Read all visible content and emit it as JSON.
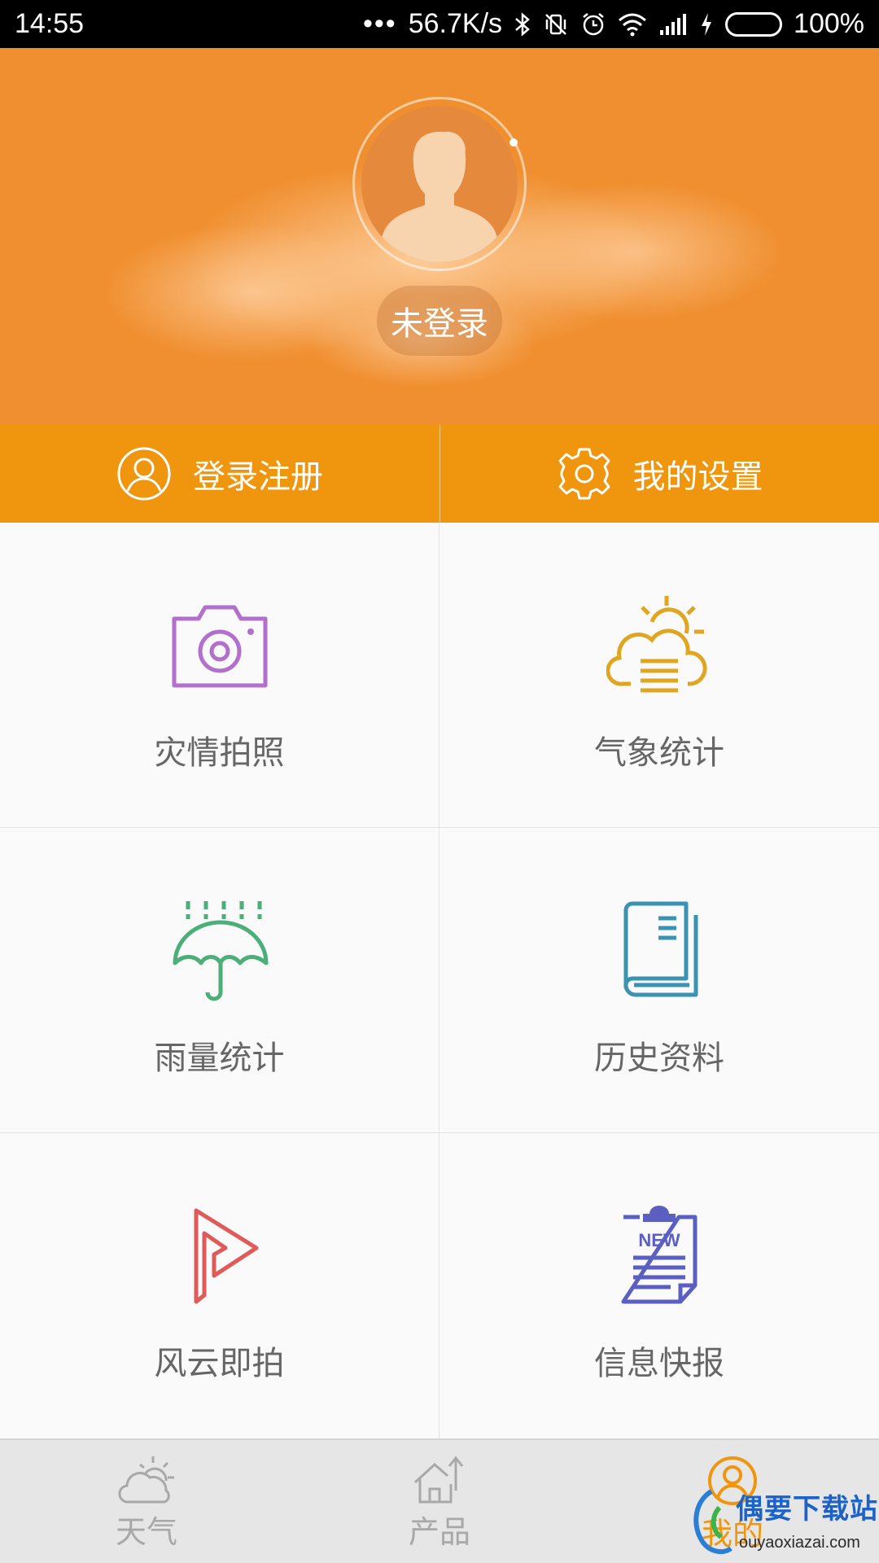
{
  "status_bar": {
    "time": "14:55",
    "dots": "•••",
    "speed": "56.7K/s",
    "battery_pct": "100%"
  },
  "profile": {
    "login_status": "未登录"
  },
  "actions": {
    "login": "登录注册",
    "settings": "我的设置"
  },
  "grid": {
    "items": [
      {
        "label": "灾情拍照",
        "icon": "camera-icon",
        "color": "#b36fcc"
      },
      {
        "label": "气象统计",
        "icon": "sun-cloud-icon",
        "color": "#e0a61f"
      },
      {
        "label": "雨量统计",
        "icon": "umbrella-rain-icon",
        "color": "#4caf7a"
      },
      {
        "label": "历史资料",
        "icon": "book-icon",
        "color": "#3a93b3"
      },
      {
        "label": "风云即拍",
        "icon": "play-arrow-icon",
        "color": "#e05a5a"
      },
      {
        "label": "信息快报",
        "icon": "news-clipboard-icon",
        "color": "#5b5fc0"
      }
    ]
  },
  "bottom_nav": {
    "items": [
      {
        "label": "天气",
        "icon": "weather-icon",
        "active": false
      },
      {
        "label": "产品",
        "icon": "house-icon",
        "active": false
      },
      {
        "label": "我的",
        "icon": "user-icon",
        "active": true
      }
    ]
  },
  "watermark": {
    "title": "偶要下载站",
    "url": "ouyaoxiazai.com"
  },
  "colors": {
    "accent": "#ef960e",
    "hero": "#f08f30"
  }
}
